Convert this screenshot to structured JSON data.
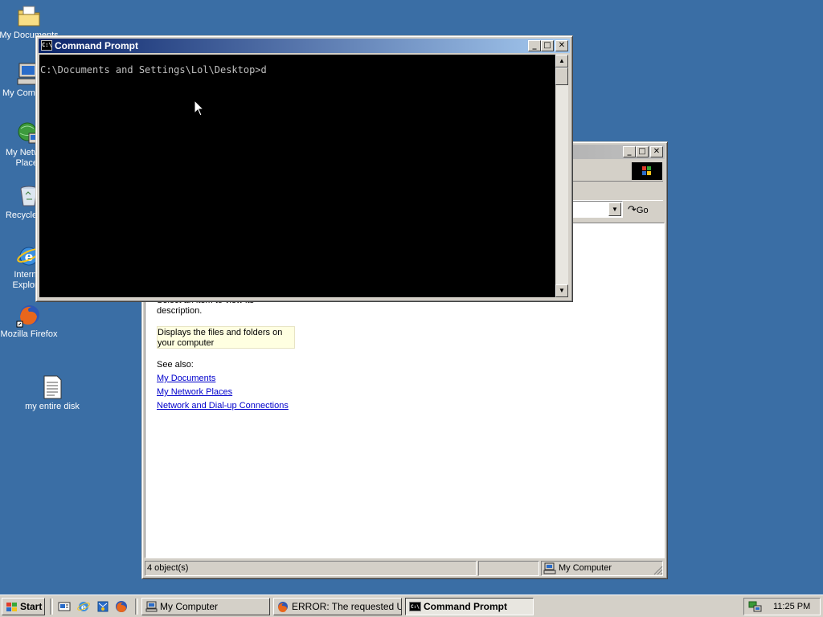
{
  "desktop": {
    "icons": [
      {
        "label": "My Documents",
        "icon": "folder-documents-icon"
      },
      {
        "label": "My Computer",
        "icon": "computer-icon"
      },
      {
        "label": "My Network Places",
        "icon": "network-places-icon"
      },
      {
        "label": "Recycle Bin",
        "icon": "recycle-bin-icon"
      },
      {
        "label": "Internet Explorer",
        "icon": "internet-explorer-icon"
      },
      {
        "label": "Mozilla Firefox",
        "icon": "firefox-icon"
      },
      {
        "label": "my entire disk",
        "icon": "text-document-icon"
      }
    ]
  },
  "cmd": {
    "title": "Command Prompt",
    "prompt_line": "C:\\Documents and Settings\\Lol\\Desktop>d"
  },
  "explorer": {
    "go_label": "Go",
    "description_hint": "Select an item to view its description.",
    "info_text": "Displays the files and folders on your computer",
    "see_also_label": "See also:",
    "see_also_links": [
      "My Documents",
      "My Network Places",
      "Network and Dial-up Connections"
    ],
    "status_count": "4 object(s)",
    "status_location": "My Computer"
  },
  "taskbar": {
    "start_label": "Start",
    "quick_launch": [
      "show-desktop-icon",
      "internet-explorer-icon",
      "outlook-express-icon",
      "firefox-icon"
    ],
    "buttons": [
      {
        "label": "My Computer",
        "active": false
      },
      {
        "label": "ERROR: The requested U...",
        "active": false
      },
      {
        "label": "Command Prompt",
        "active": true
      }
    ],
    "clock": "11:25 PM"
  },
  "colors": {
    "desktop": "#3a6ea5",
    "title_active": "#0a246a",
    "window_face": "#d4d0c8"
  }
}
